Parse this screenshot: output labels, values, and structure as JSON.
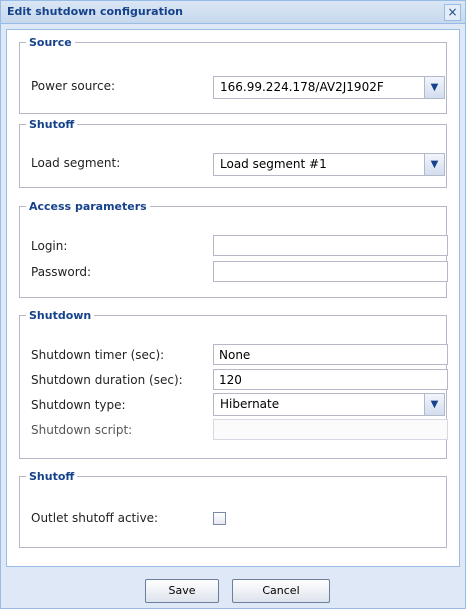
{
  "window": {
    "title": "Edit shutdown configuration",
    "close_glyph": "×"
  },
  "source": {
    "legend": "Source",
    "power_source_label": "Power source:",
    "power_source_value": "166.99.224.178/AV2J1902F"
  },
  "shutoff_load": {
    "legend": "Shutoff",
    "load_segment_label": "Load segment:",
    "load_segment_value": "Load segment #1"
  },
  "access": {
    "legend": "Access parameters",
    "login_label": "Login:",
    "login_value": "",
    "password_label": "Password:",
    "password_value": ""
  },
  "shutdown": {
    "legend": "Shutdown",
    "timer_label": "Shutdown timer (sec):",
    "timer_value": "None",
    "duration_label": "Shutdown duration (sec):",
    "duration_value": "120",
    "type_label": "Shutdown type:",
    "type_value": "Hibernate",
    "script_label": "Shutdown script:",
    "script_value": ""
  },
  "shutoff_outlet": {
    "legend": "Shutoff",
    "outlet_label": "Outlet shutoff active:",
    "outlet_checked": false
  },
  "buttons": {
    "save_label": "Save",
    "cancel_label": "Cancel"
  },
  "icons": {
    "dropdown": "chevron-down-icon",
    "close": "close-icon"
  },
  "colors": {
    "title_text": "#15428b",
    "frame_border": "#99bbe8",
    "dialog_background": "#dfe8f6"
  }
}
